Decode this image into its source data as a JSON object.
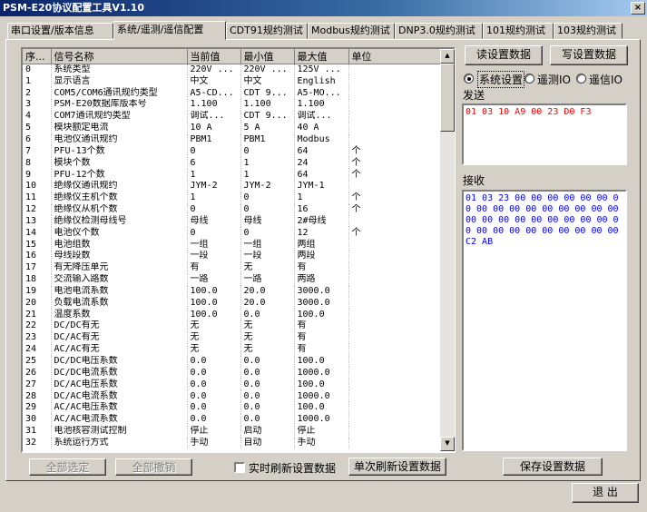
{
  "window": {
    "title": "PSM-E20协议配置工具V1.10",
    "close": "×"
  },
  "tabs": [
    {
      "label": "串口设置/版本信息"
    },
    {
      "label": "系统/遥测/遥信配置"
    },
    {
      "label": "CDT91规约测试"
    },
    {
      "label": "Modbus规约测试"
    },
    {
      "label": "DNP3.0规约测试"
    },
    {
      "label": "101规约测试"
    },
    {
      "label": "103规约测试"
    }
  ],
  "grid": {
    "columns": [
      "序...",
      "信号名称",
      "当前值",
      "最小值",
      "最大值",
      "单位"
    ],
    "rows": [
      [
        "0",
        "系统类型",
        "220V ...",
        "220V ...",
        "125V ...",
        ""
      ],
      [
        "1",
        "显示语言",
        "中文",
        "中文",
        "English",
        ""
      ],
      [
        "2",
        "COM5/COM6通讯规约类型",
        "A5-CD...",
        "CDT 9...",
        "A5-MO...",
        ""
      ],
      [
        "3",
        "PSM-E20数据库版本号",
        "1.100",
        "1.100",
        "1.100",
        ""
      ],
      [
        "4",
        "COM7通讯规约类型",
        "调试...",
        "CDT 9...",
        "调试...",
        ""
      ],
      [
        "5",
        "模块额定电流",
        "10 A",
        "5 A",
        "40 A",
        ""
      ],
      [
        "6",
        "电池仪通讯规约",
        "PBM1",
        "PBM1",
        "Modbus",
        ""
      ],
      [
        "7",
        "PFU-13个数",
        "0",
        "0",
        "64",
        "个"
      ],
      [
        "8",
        "模块个数",
        "6",
        "1",
        "24",
        "个"
      ],
      [
        "9",
        "PFU-12个数",
        "1",
        "1",
        "64",
        "个"
      ],
      [
        "10",
        "绝缘仪通讯规约",
        "JYM-2",
        "JYM-2",
        "JYM-1",
        ""
      ],
      [
        "11",
        "绝缘仪主机个数",
        "1",
        "0",
        "1",
        "个"
      ],
      [
        "12",
        "绝缘仪从机个数",
        "0",
        "0",
        "16",
        "个"
      ],
      [
        "13",
        "绝缘仪检测母线号",
        "母线",
        "母线",
        "2#母线",
        ""
      ],
      [
        "14",
        "电池仪个数",
        "0",
        "0",
        "12",
        "个"
      ],
      [
        "15",
        "电池组数",
        "一组",
        "一组",
        "两组",
        ""
      ],
      [
        "16",
        "母线段数",
        "一段",
        "一段",
        "两段",
        ""
      ],
      [
        "17",
        "有无降压单元",
        "有",
        "无",
        "有",
        ""
      ],
      [
        "18",
        "交流输入路数",
        "一路",
        "一路",
        "两路",
        ""
      ],
      [
        "19",
        "电池电流系数",
        "100.0",
        "20.0",
        "3000.0",
        ""
      ],
      [
        "20",
        "负载电流系数",
        "100.0",
        "20.0",
        "3000.0",
        ""
      ],
      [
        "21",
        "温度系数",
        "100.0",
        "0.0",
        "100.0",
        ""
      ],
      [
        "22",
        "DC/DC有无",
        "无",
        "无",
        "有",
        ""
      ],
      [
        "23",
        "DC/AC有无",
        "无",
        "无",
        "有",
        ""
      ],
      [
        "24",
        "AC/AC有无",
        "无",
        "无",
        "有",
        ""
      ],
      [
        "25",
        "DC/DC电压系数",
        "0.0",
        "0.0",
        "100.0",
        ""
      ],
      [
        "26",
        "DC/DC电流系数",
        "0.0",
        "0.0",
        "1000.0",
        ""
      ],
      [
        "27",
        "DC/AC电压系数",
        "0.0",
        "0.0",
        "100.0",
        ""
      ],
      [
        "28",
        "DC/AC电流系数",
        "0.0",
        "0.0",
        "1000.0",
        ""
      ],
      [
        "29",
        "AC/AC电压系数",
        "0.0",
        "0.0",
        "100.0",
        ""
      ],
      [
        "30",
        "AC/AC电流系数",
        "0.0",
        "0.0",
        "1000.0",
        ""
      ],
      [
        "31",
        "电池核容测试控制",
        "停止",
        "启动",
        "停止",
        ""
      ],
      [
        "32",
        "系统运行方式",
        "手动",
        "自动",
        "手动",
        ""
      ]
    ]
  },
  "buttons": {
    "read": "读设置数据",
    "write": "写设置数据",
    "select_all": "全部选定",
    "deselect_all": "全部撤销",
    "refresh_once": "单次刷新设置数据",
    "save": "保存设置数据",
    "exit": "退 出"
  },
  "radios": {
    "system": "系统设置",
    "telemetry": "遥测IO",
    "telesignal": "遥信IO"
  },
  "realtime_label": "实时刷新设置数据",
  "send": {
    "label": "发送",
    "content": "01 03 10 A9 00 23 D0 F3",
    "color": "#ff0000"
  },
  "receive": {
    "label": "接收",
    "content": "01 03 23 00 00 00 00 00 00 00 00 00 00 00 00 00 00 00 00 00 00 00 00 00 00 00 00 00 00 00 00 00 00 00 00 00 00 00 C2 AB",
    "color": "#0000ff"
  }
}
